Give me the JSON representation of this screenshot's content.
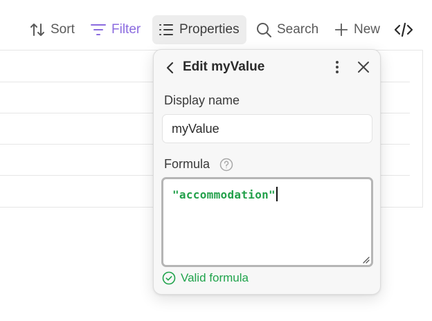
{
  "toolbar": {
    "sort_label": "Sort",
    "filter_label": "Filter",
    "properties_label": "Properties",
    "search_label": "Search",
    "new_label": "New",
    "code_icon": "code-icon"
  },
  "colors": {
    "filter_active": "#8b6bdf",
    "formula_text": "#22a04a",
    "valid_text": "#1fa34b",
    "popup_bg": "#f7f7f7"
  },
  "popup": {
    "title": "Edit myValue",
    "display_name_label": "Display name",
    "display_name_value": "myValue",
    "formula_label": "Formula",
    "formula_value": "\"accommodation\"",
    "valid_message": "Valid formula"
  }
}
